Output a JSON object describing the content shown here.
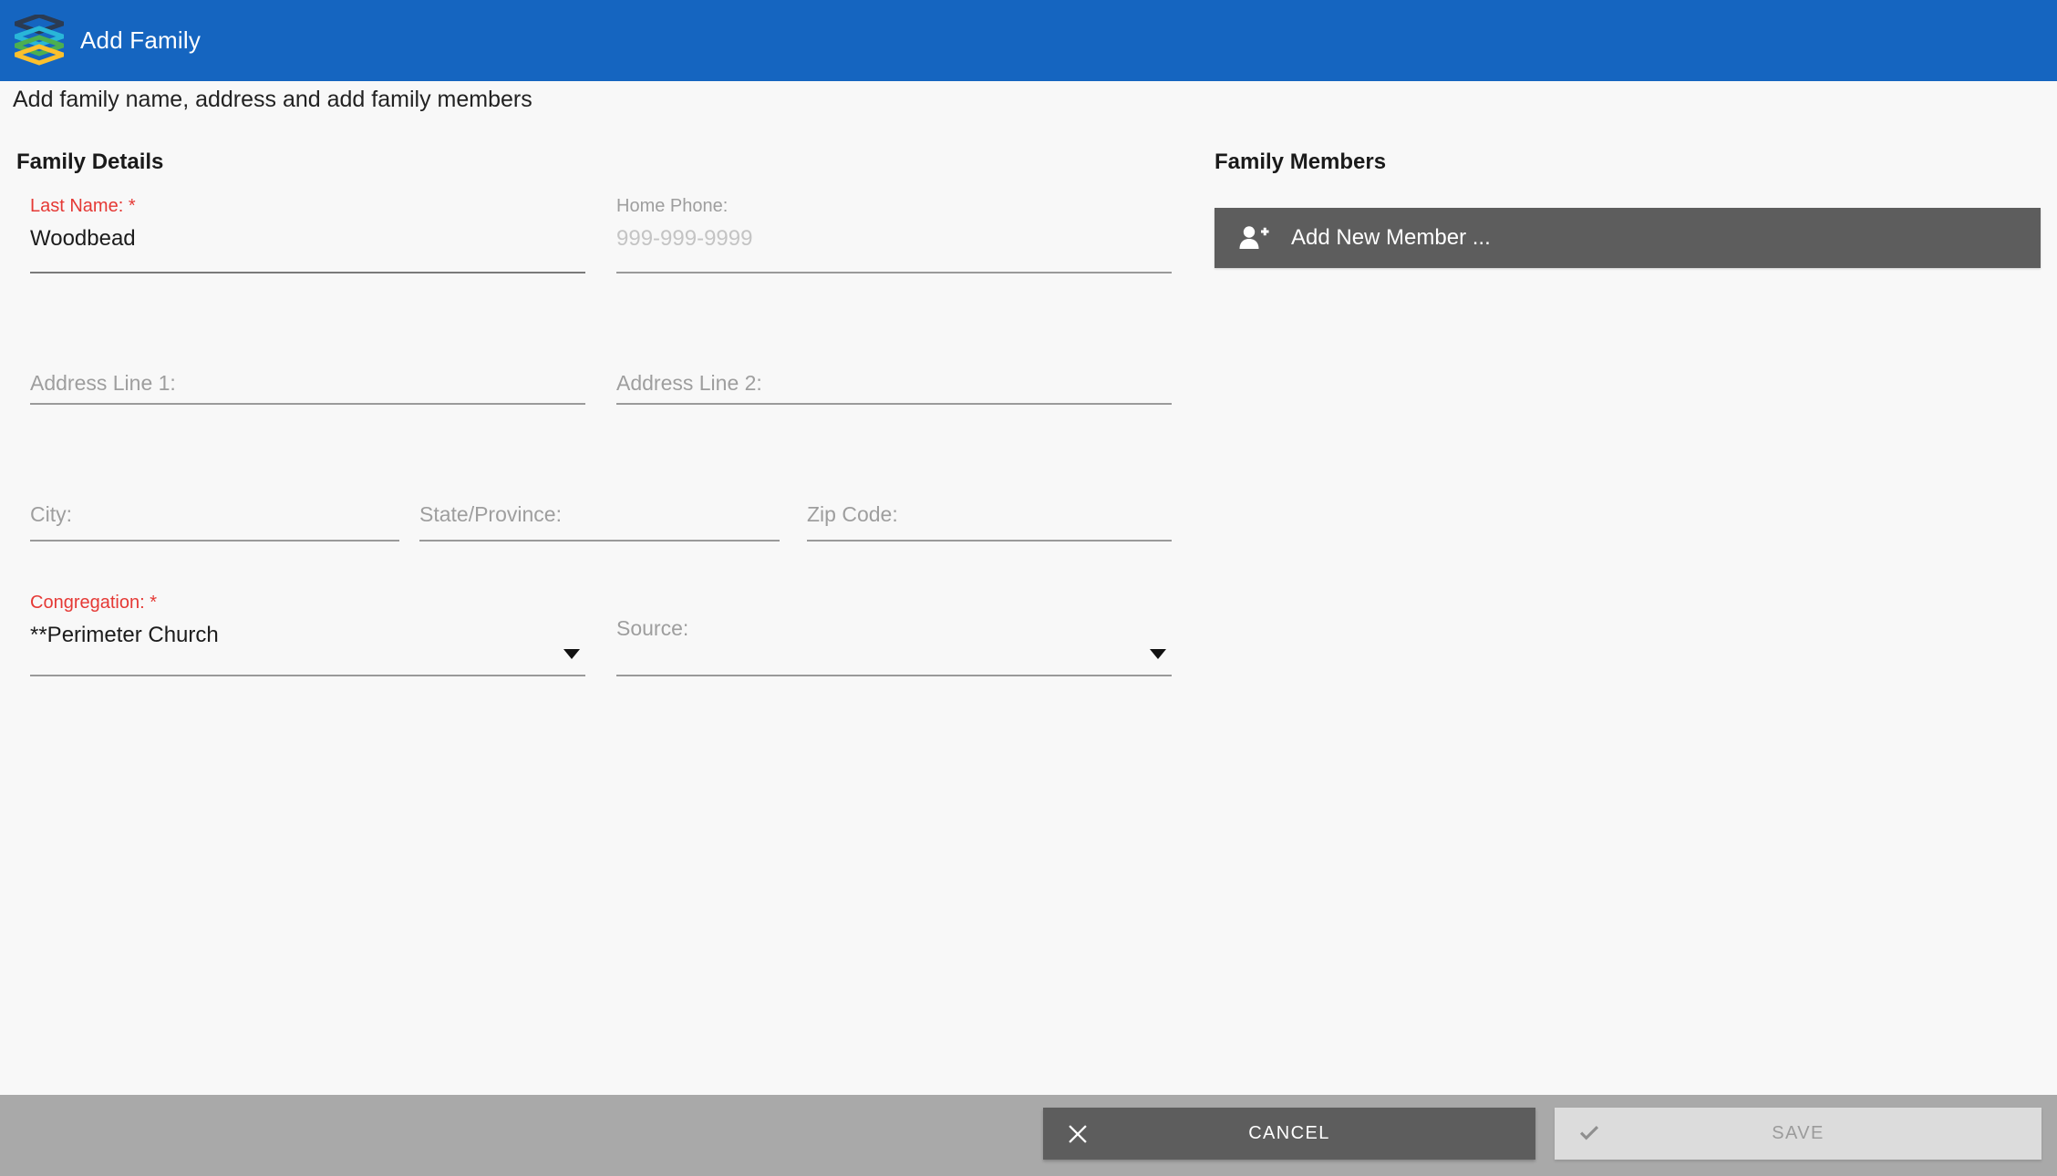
{
  "header": {
    "title": "Add Family",
    "logo_icon": "stacked-layers-icon",
    "background_color": "#1565c0",
    "logo_colors": [
      "#2b3b52",
      "#29b6d8",
      "#4caf50",
      "#fbc02d"
    ]
  },
  "page": {
    "subtitle": "Add family name, address and add family members",
    "background_color": "#f8f8f8"
  },
  "family_details": {
    "title": "Family Details",
    "fields": {
      "last_name": {
        "label": "Last Name: *",
        "value": "Woodbead",
        "required": true,
        "required_color": "#e53935"
      },
      "home_phone": {
        "label": "Home Phone:",
        "value": "",
        "placeholder": "999-999-9999",
        "required": false
      },
      "address_line_1": {
        "label": "Address Line 1:",
        "value": "",
        "required": false
      },
      "address_line_2": {
        "label": "Address Line 2:",
        "value": "",
        "required": false
      },
      "city": {
        "label": "City:",
        "value": "",
        "required": false
      },
      "state_province": {
        "label": "State/Province:",
        "value": "",
        "required": false
      },
      "zip_code": {
        "label": "Zip Code:",
        "value": "",
        "required": false
      },
      "congregation": {
        "label": "Congregation: *",
        "value": "**Perimeter Church",
        "required": true,
        "required_color": "#e53935",
        "control": "dropdown",
        "caret_icon": "chevron-down-icon"
      },
      "source": {
        "label": "Source:",
        "value": "",
        "required": false,
        "control": "dropdown",
        "caret_icon": "chevron-down-icon"
      }
    }
  },
  "family_members": {
    "title": "Family Members",
    "add_button": {
      "label": "Add New Member ...",
      "icon": "person-plus-icon",
      "background_color": "#5d5d5d"
    }
  },
  "footer": {
    "background_color": "#a9a9a9",
    "cancel": {
      "label": "CANCEL",
      "icon": "close-x-icon",
      "background_color": "#5d5d5d",
      "enabled": true
    },
    "save": {
      "label": "SAVE",
      "icon": "checkmark-icon",
      "background_color": "#dcdcdc",
      "enabled": false
    }
  }
}
